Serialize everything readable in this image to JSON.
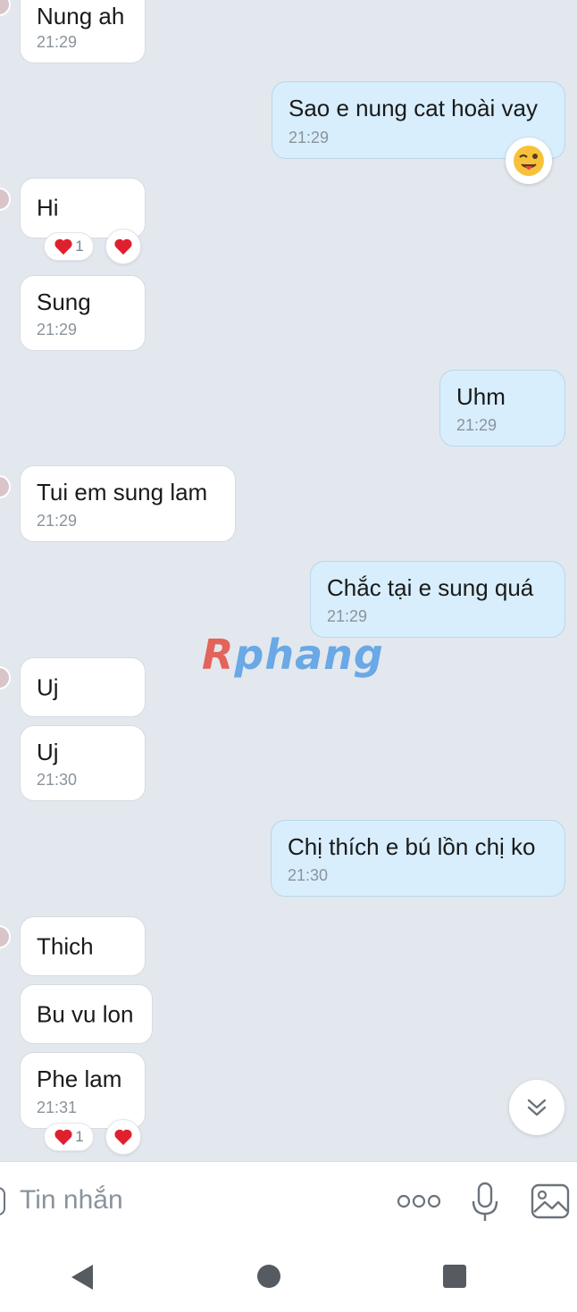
{
  "messages": [
    {
      "dir": "in",
      "text": "Nung ah",
      "time": "21:29"
    },
    {
      "dir": "out",
      "text": "Sao e nung cat hoài vay",
      "time": "21:29",
      "reaction_emoji": "winking-tongue-face"
    },
    {
      "dir": "in",
      "text": "Hi",
      "reactions": {
        "count": "1"
      }
    },
    {
      "dir": "in",
      "text": "Sung",
      "time": "21:29"
    },
    {
      "dir": "out",
      "text": "Uhm",
      "time": "21:29"
    },
    {
      "dir": "in",
      "text": "Tui em sung lam",
      "time": "21:29"
    },
    {
      "dir": "out",
      "text": "Chắc tại e sung quá",
      "time": "21:29"
    },
    {
      "dir": "in",
      "text": "Uj"
    },
    {
      "dir": "in",
      "text": "Uj",
      "time": "21:30"
    },
    {
      "dir": "out",
      "text": "Chị thích e bú lồn chị ko",
      "time": "21:30"
    },
    {
      "dir": "in",
      "text": "Thich"
    },
    {
      "dir": "in",
      "text": "Bu vu lon"
    },
    {
      "dir": "in",
      "text": "Phe lam",
      "time": "21:31",
      "reactions": {
        "count": "1"
      }
    }
  ],
  "watermark": {
    "first": "R",
    "rest": "phang"
  },
  "composer": {
    "placeholder": "Tin nhắn"
  },
  "icons": {
    "reaction": "heart-icon",
    "more": "more-options-icon",
    "mic": "microphone-icon",
    "image": "image-icon",
    "scroll": "chevron-double-down-icon",
    "nav_back": "back-triangle-icon",
    "nav_home": "home-circle-icon",
    "nav_recent": "recents-square-icon"
  },
  "colors": {
    "background": "#e3e8ee",
    "incoming_bubble": "#ffffff",
    "outgoing_bubble": "#d8eefc",
    "timestamp": "#8a939c",
    "heart": "#e0202e"
  }
}
